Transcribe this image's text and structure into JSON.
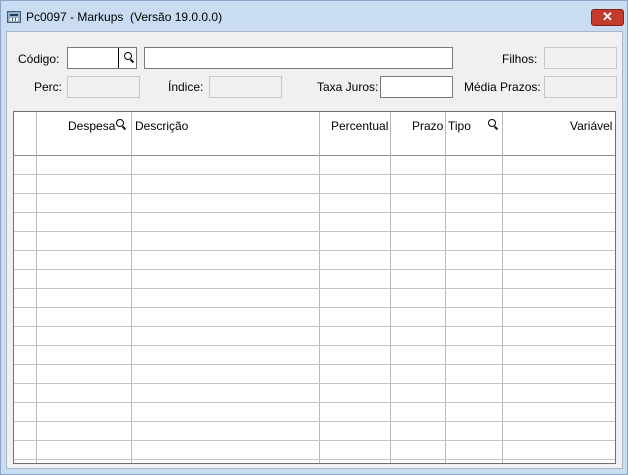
{
  "window": {
    "title": "Pc0097 - Markups  (Versão 19.0.0.0)",
    "close_label": "✕",
    "icon": "calculator-icon",
    "accent_color": "#c43b2b"
  },
  "form": {
    "codigo_label": "Código:",
    "codigo_value": "",
    "descricao_value": "",
    "filhos_label": "Filhos:",
    "filhos_value": "",
    "perc_label": "Perc:",
    "perc_value": "",
    "indice_label": "Índice:",
    "indice_value": "",
    "taxa_juros_label": "Taxa Juros:",
    "taxa_juros_value": "",
    "media_prazos_label": "Média Prazos:",
    "media_prazos_value": ""
  },
  "grid": {
    "columns": [
      {
        "key": "rowsel",
        "label": ""
      },
      {
        "key": "despesa",
        "label": "Despesa",
        "lookup_icon": "search-icon"
      },
      {
        "key": "descricao",
        "label": "Descrição"
      },
      {
        "key": "percentual",
        "label": "Percentual"
      },
      {
        "key": "prazo",
        "label": "Prazo"
      },
      {
        "key": "tipo",
        "label": "Tipo",
        "lookup_icon": "search-icon"
      },
      {
        "key": "variavel",
        "label": "Variável"
      }
    ],
    "rows": []
  }
}
